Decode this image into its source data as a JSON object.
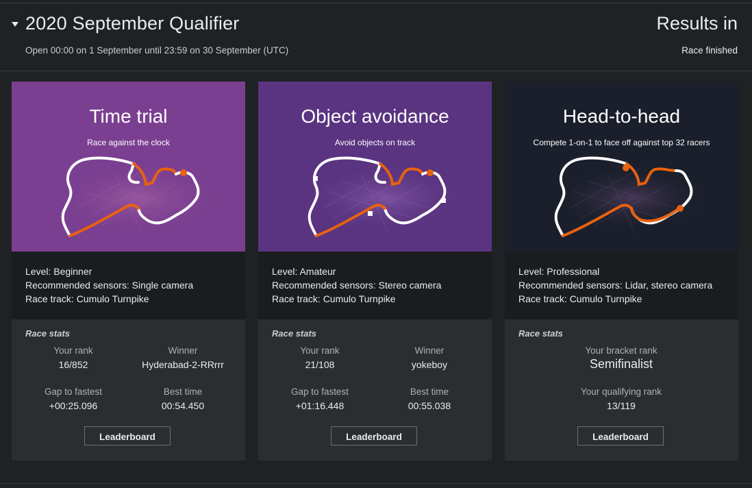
{
  "header": {
    "title": "2020 September Qualifier",
    "subtitle": "Open 00:00 on 1 September until 23:59 on 30 September (UTC)",
    "results_label": "Results in",
    "status": "Race finished"
  },
  "cards": [
    {
      "title": "Time trial",
      "subtitle": "Race against the clock",
      "level": "Level: Beginner",
      "sensors": "Recommended sensors: Single camera",
      "track": "Race track: Cumulo Turnpike",
      "stats_title": "Race stats",
      "rank_label": "Your rank",
      "rank_value": "16/852",
      "winner_label": "Winner",
      "winner_value": "Hyderabad-2-RRrrr",
      "gap_label": "Gap to fastest",
      "gap_value": "+00:25.096",
      "best_label": "Best time",
      "best_value": "00:54.450",
      "button": "Leaderboard",
      "color": "#7b3f91"
    },
    {
      "title": "Object avoidance",
      "subtitle": "Avoid objects on track",
      "level": "Level: Amateur",
      "sensors": "Recommended sensors: Stereo camera",
      "track": "Race track: Cumulo Turnpike",
      "stats_title": "Race stats",
      "rank_label": "Your rank",
      "rank_value": "21/108",
      "winner_label": "Winner",
      "winner_value": "yokeboy",
      "gap_label": "Gap to fastest",
      "gap_value": "+01:16.448",
      "best_label": "Best time",
      "best_value": "00:55.038",
      "button": "Leaderboard",
      "color": "#5a3480"
    },
    {
      "title": "Head-to-head",
      "subtitle": "Compete 1-on-1 to face off against top 32 racers",
      "level": "Level: Professional",
      "sensors": "Recommended sensors: Lidar, stereo camera",
      "track": "Race track: Cumulo Turnpike",
      "stats_title": "Race stats",
      "bracket_label": "Your bracket rank",
      "bracket_value": "Semifinalist",
      "qual_label": "Your qualifying rank",
      "qual_value": "13/119",
      "button": "Leaderboard",
      "color": "#1a1f2b"
    }
  ],
  "accent": "#e8620f"
}
